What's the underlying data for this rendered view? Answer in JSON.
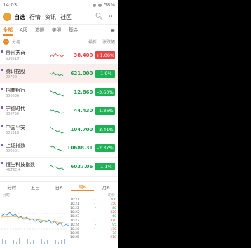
{
  "status": {
    "time": "14:03",
    "battery": "58%"
  },
  "header": {
    "nav": [
      "自选",
      "行情",
      "资讯",
      "社区"
    ],
    "search_icon": "search-icon",
    "more_icon": "more-icon"
  },
  "tabs": [
    "全部",
    "A股",
    "港股",
    "美股",
    "基金"
  ],
  "subtabs": {
    "left": "分组",
    "right": [
      "最新",
      "涨跌幅"
    ]
  },
  "stocks": [
    {
      "name": "贵州茅台",
      "code": "600519",
      "price": "38.400",
      "change": "+1.06%",
      "up": true
    },
    {
      "name": "腾讯控股",
      "code": "00700",
      "price": "621.000",
      "change": "-1.9%",
      "up": false
    },
    {
      "name": "招商银行",
      "code": "600036",
      "price": "12.860",
      "change": "-3.60%",
      "up": false
    },
    {
      "name": "宁德时代",
      "code": "300750",
      "price": "44.430",
      "change": "-1.86%",
      "up": false
    },
    {
      "name": "中国平安",
      "code": "601318",
      "price": "104.700",
      "change": "-3.41%",
      "up": false
    },
    {
      "name": "上证指数",
      "code": "000001",
      "price": "10688.31",
      "change": "-2.37%",
      "up": false
    },
    {
      "name": "恒生科技指数",
      "code": "HSTECH",
      "price": "6037.06",
      "change": "-1.1%",
      "up": false
    }
  ],
  "bottom_tabs": [
    "分时",
    "五日",
    "日K",
    "周K",
    "月K"
  ],
  "bottom_active": 3,
  "chart_hdr": {
    "left": "分时",
    "right": "均价"
  },
  "tape": [
    {
      "t": "10:21",
      "p": "-",
      "v": "200"
    },
    {
      "t": "10:21",
      "p": "-",
      "v": "150"
    },
    {
      "t": "10:22",
      "p": "-",
      "v": "80"
    },
    {
      "t": "10:22",
      "p": "-",
      "v": "320"
    },
    {
      "t": "10:23",
      "p": "-",
      "v": "60"
    },
    {
      "t": "10:23",
      "p": "-",
      "v": "410"
    },
    {
      "t": "10:24",
      "p": "-",
      "v": "95"
    },
    {
      "t": "10:24",
      "p": "-",
      "v": "130"
    },
    {
      "t": "10:25",
      "p": "-",
      "v": "70"
    },
    {
      "t": "10:25",
      "p": "-",
      "v": "210"
    }
  ]
}
